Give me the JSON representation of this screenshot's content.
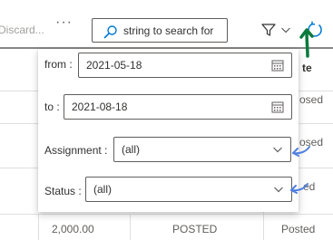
{
  "toolbar": {
    "discard_label": "Discard...",
    "more_label": "···",
    "search_placeholder": "string to search for",
    "search_icon": "search-icon",
    "filter_icon": "filter-icon",
    "chevron_icon": "chevron-down-icon",
    "refresh_icon": "refresh-icon"
  },
  "table": {
    "header_status_fragment": "te",
    "rows": [
      {
        "status_fragment": "osed"
      },
      {
        "status_fragment": "osed"
      },
      {
        "status_fragment": "ed"
      },
      {
        "amount": "2,000.00",
        "state": "POSTED",
        "status": "Posted"
      }
    ]
  },
  "filter_panel": {
    "from_label": "from :",
    "from_value": "2021-05-18",
    "to_label": "to :",
    "to_value": "2021-08-18",
    "assignment_label": "Assignment :",
    "assignment_value": "(all)",
    "status_label": "Status :",
    "status_value": "(all)",
    "calendar_icon": "calendar-icon"
  },
  "colors": {
    "accent": "#0078d4",
    "annotation_green": "#0a7a3c",
    "annotation_blue": "#4f7fe0",
    "border": "#605e5c"
  }
}
